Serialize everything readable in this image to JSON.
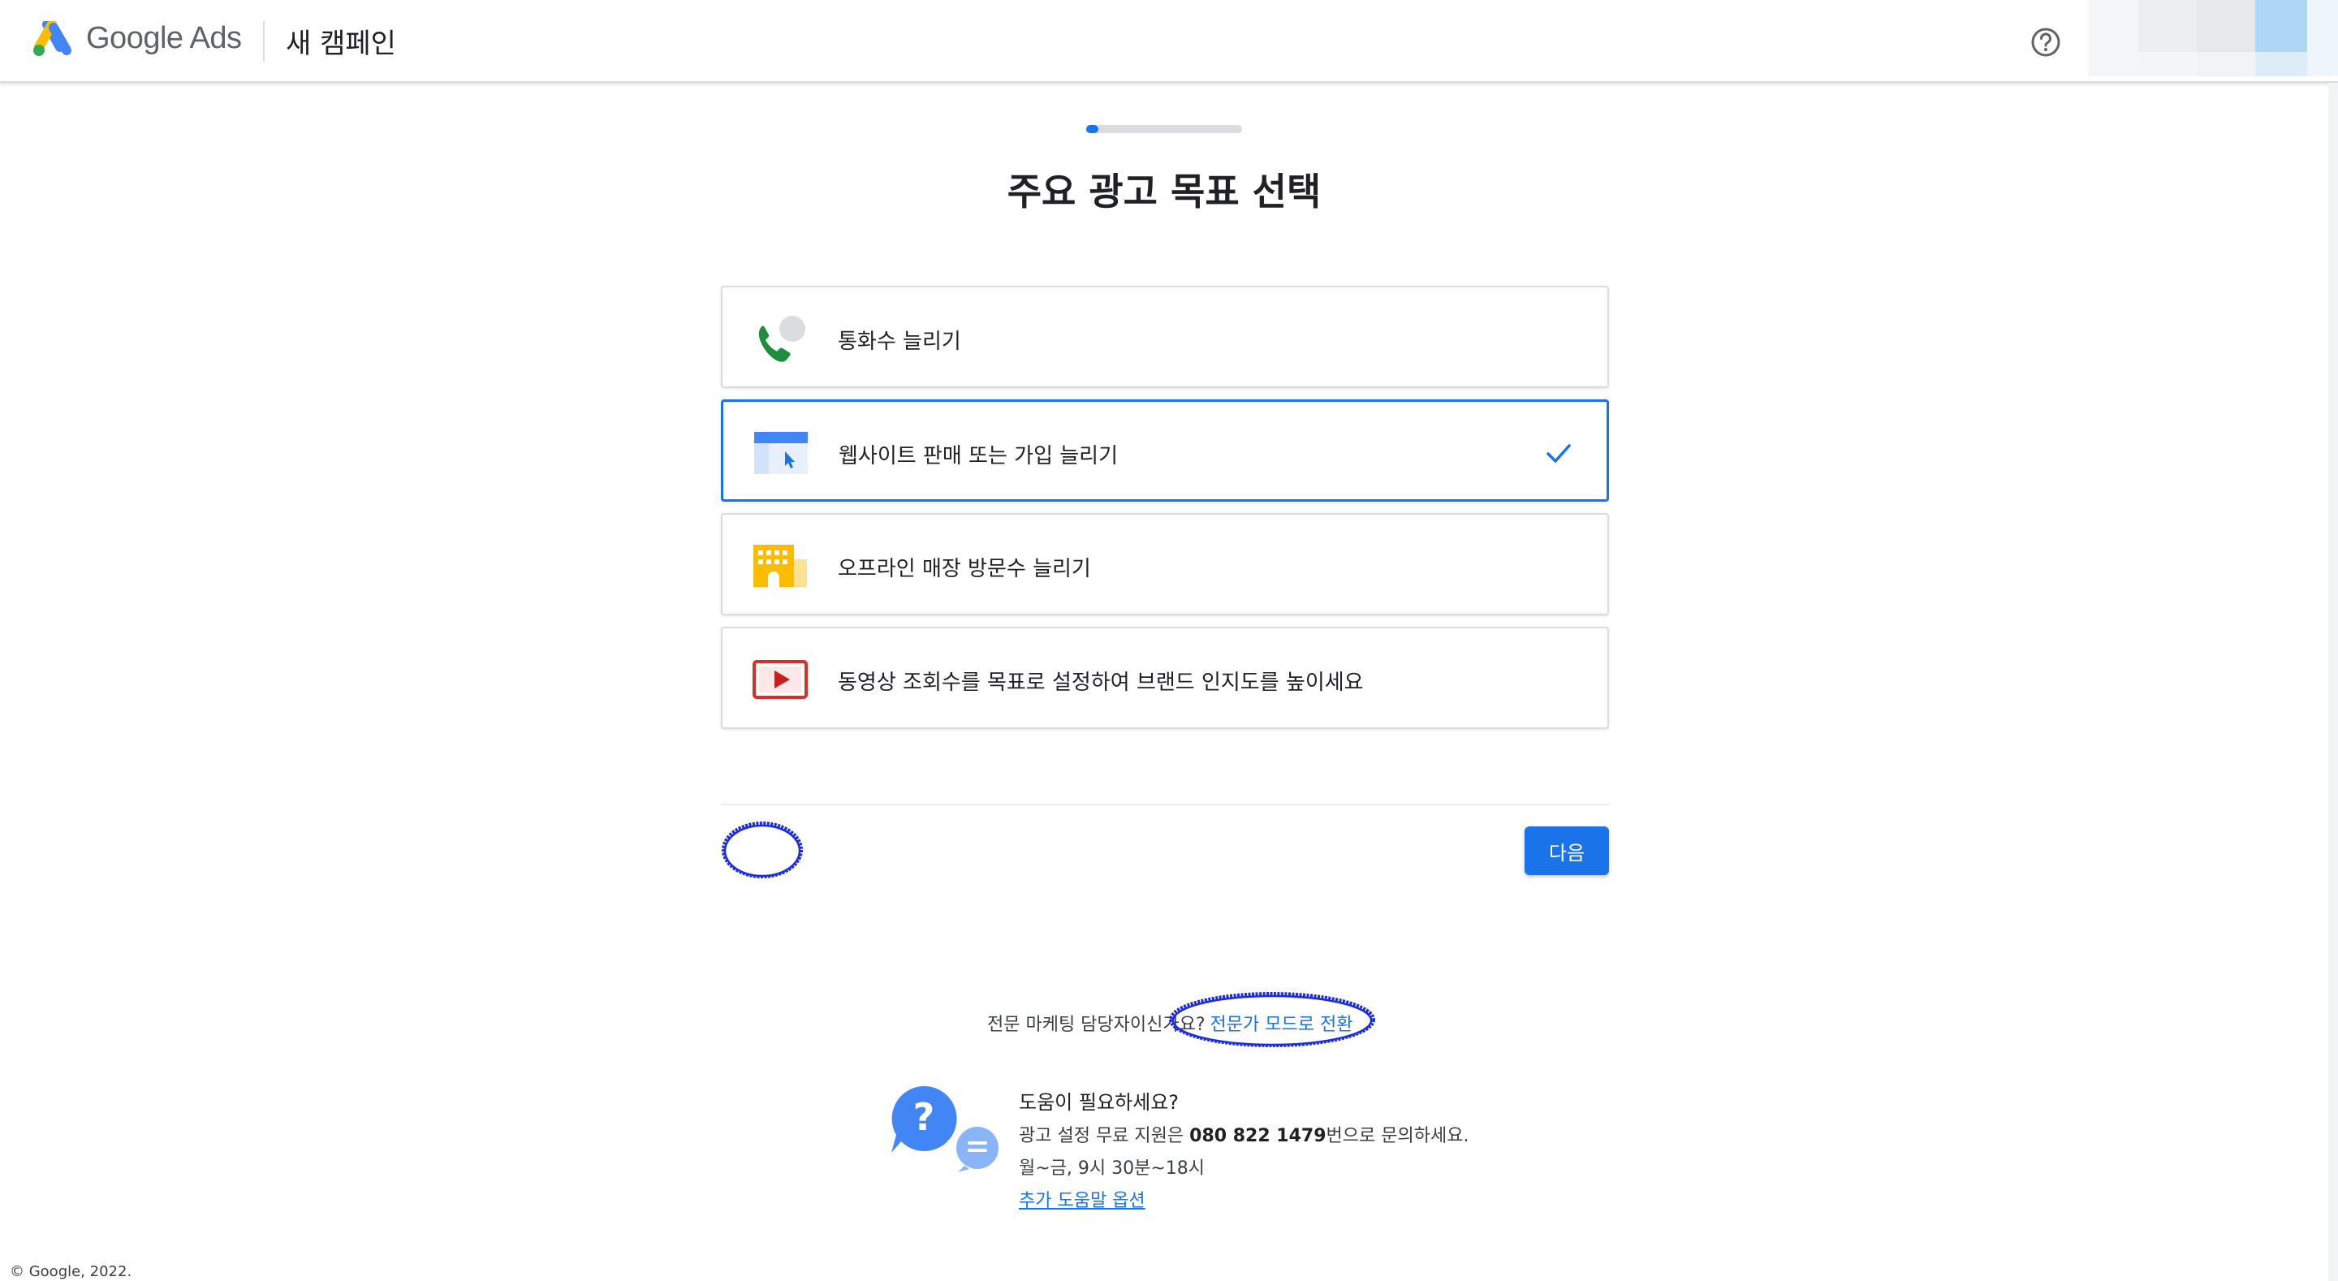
{
  "header": {
    "brand_google": "Google",
    "brand_ads": "Ads",
    "campaign_title": "새 캠페인",
    "help_icon": "help-circle-icon"
  },
  "progress": {
    "fraction": 0.08
  },
  "page": {
    "title": "주요 광고 목표 선택"
  },
  "options": [
    {
      "label": "통화수 늘리기",
      "icon": "phone-call-icon",
      "selected": false
    },
    {
      "label": "웹사이트 판매 또는 가입 늘리기",
      "icon": "website-icon",
      "selected": true
    },
    {
      "label": "오프라인 매장 방문수 늘리기",
      "icon": "store-icon",
      "selected": false
    },
    {
      "label": "동영상 조회수를 목표로 설정하여 브랜드 인지도를 높이세요",
      "icon": "video-play-icon",
      "selected": false
    }
  ],
  "actions": {
    "next_label": "다음"
  },
  "expert": {
    "question": "전문 마케팅 담당자이신가요?",
    "link": "전문가 모드로 전환"
  },
  "help": {
    "title": "도움이 필요하세요?",
    "line1_prefix": "광고 설정 무료 지원은 ",
    "phone": "080 822 1479",
    "line1_suffix": "번으로 문의하세요.",
    "hours": "월~금, 9시 30분~18시",
    "more_link": "추가 도움말 옵션"
  },
  "footer": {
    "copyright": "© Google, 2022."
  },
  "colors": {
    "primary": "#1a73e8",
    "scribble": "#1a2be8",
    "card_border": "#dadce0"
  }
}
